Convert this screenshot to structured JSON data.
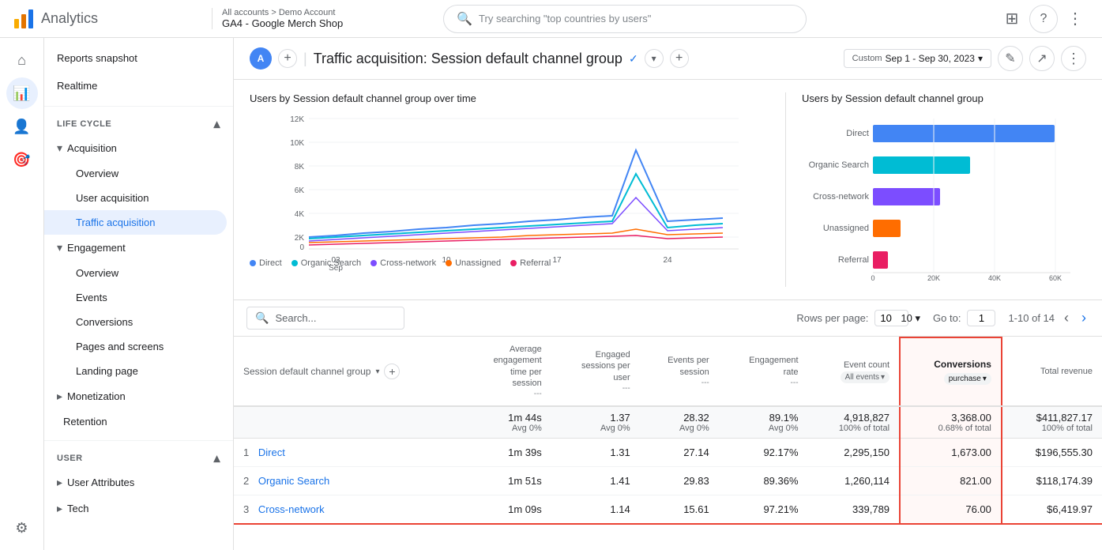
{
  "header": {
    "analytics_title": "Analytics",
    "breadcrumb": "All accounts > Demo Account",
    "property": "GA4 - Google Merch Shop",
    "search_placeholder": "Try searching \"top countries by users\"",
    "page_title": "Traffic acquisition: Session default channel group",
    "date_range": "Sep 1 - Sep 30, 2023",
    "date_label": "Custom"
  },
  "sidebar": {
    "top_items": [
      {
        "label": "Reports snapshot",
        "icon": "🏠"
      },
      {
        "label": "Realtime",
        "icon": "⏱"
      }
    ],
    "lifecycle_section": "Life cycle",
    "groups": [
      {
        "label": "Acquisition",
        "expanded": true,
        "items": [
          {
            "label": "Overview",
            "active": false
          },
          {
            "label": "User acquisition",
            "active": false
          },
          {
            "label": "Traffic acquisition",
            "active": true
          }
        ]
      },
      {
        "label": "Engagement",
        "expanded": true,
        "items": [
          {
            "label": "Overview",
            "active": false
          },
          {
            "label": "Events",
            "active": false
          },
          {
            "label": "Conversions",
            "active": false
          },
          {
            "label": "Pages and screens",
            "active": false
          },
          {
            "label": "Landing page",
            "active": false
          }
        ]
      },
      {
        "label": "Monetization",
        "expanded": false,
        "items": []
      },
      {
        "label": "Retention",
        "expanded": false,
        "items": []
      }
    ],
    "user_section": "User",
    "user_groups": [
      {
        "label": "User Attributes",
        "expanded": false
      },
      {
        "label": "Tech",
        "expanded": false
      }
    ]
  },
  "line_chart": {
    "title": "Users by Session default channel group over time",
    "x_labels": [
      "03 Sep",
      "10",
      "17",
      "24"
    ],
    "y_labels": [
      "12K",
      "10K",
      "8K",
      "6K",
      "4K",
      "2K",
      "0"
    ],
    "legend": [
      {
        "label": "Direct",
        "color": "#4285f4"
      },
      {
        "label": "Organic Search",
        "color": "#00bcd4"
      },
      {
        "label": "Cross-network",
        "color": "#7c4dff"
      },
      {
        "label": "Unassigned",
        "color": "#ff6d00"
      },
      {
        "label": "Referral",
        "color": "#e91e63"
      }
    ]
  },
  "bar_chart": {
    "title": "Users by Session default channel group",
    "categories": [
      {
        "label": "Direct",
        "value": 60000,
        "color": "#4285f4"
      },
      {
        "label": "Organic Search",
        "value": 32000,
        "color": "#00bcd4"
      },
      {
        "label": "Cross-network",
        "value": 22000,
        "color": "#7c4dff"
      },
      {
        "label": "Unassigned",
        "value": 9000,
        "color": "#ff6d00"
      },
      {
        "label": "Referral",
        "value": 5000,
        "color": "#e91e63"
      }
    ],
    "x_labels": [
      "0",
      "20K",
      "40K",
      "60K"
    ],
    "max_value": 65000
  },
  "table": {
    "search_placeholder": "Search...",
    "rows_per_page_label": "Rows per page:",
    "rows_per_page_value": "10",
    "goto_label": "Go to:",
    "goto_value": "1",
    "pagination": "1-10 of 14",
    "channel_col_label": "Session default channel group",
    "columns": [
      {
        "label": "Average engagement time per session",
        "sub": "---"
      },
      {
        "label": "Engaged sessions per user",
        "sub": "---"
      },
      {
        "label": "Events per session",
        "sub": "---"
      },
      {
        "label": "Engagement rate",
        "sub": "---"
      },
      {
        "label": "Event count",
        "sub": "All events"
      },
      {
        "label": "Conversions",
        "sub": "purchase"
      },
      {
        "label": "Total revenue",
        "sub": ""
      }
    ],
    "summary": {
      "avg_engagement": "1m 44s",
      "avg_engagement_sub": "Avg 0%",
      "engaged_sessions": "1.37",
      "engaged_sessions_sub": "Avg 0%",
      "events_per_session": "28.32",
      "events_per_session_sub": "Avg 0%",
      "engagement_rate": "89.1%",
      "engagement_rate_sub": "Avg 0%",
      "event_count": "4,918,827",
      "event_count_sub": "100% of total",
      "conversions": "3,368.00",
      "conversions_sub": "0.68% of total",
      "total_revenue": "$411,827.17",
      "total_revenue_sub": "100% of total"
    },
    "rows": [
      {
        "rank": "1",
        "channel": "Direct",
        "avg_engagement": "1m 39s",
        "engaged_sessions": "1.31",
        "events_per_session": "27.14",
        "engagement_rate": "92.17%",
        "event_count": "2,295,150",
        "conversions": "1,673.00",
        "total_revenue": "$196,555.30"
      },
      {
        "rank": "2",
        "channel": "Organic Search",
        "avg_engagement": "1m 51s",
        "engaged_sessions": "1.41",
        "events_per_session": "29.83",
        "engagement_rate": "89.36%",
        "event_count": "1,260,114",
        "conversions": "821.00",
        "total_revenue": "$118,174.39"
      },
      {
        "rank": "3",
        "channel": "Cross-network",
        "avg_engagement": "1m 09s",
        "engaged_sessions": "1.14",
        "events_per_session": "15.61",
        "engagement_rate": "97.21%",
        "event_count": "339,789",
        "conversions": "76.00",
        "total_revenue": "$6,419.97"
      }
    ]
  },
  "icons": {
    "grid": "⊞",
    "help": "?",
    "more": "⋮",
    "search": "🔍",
    "check": "✓",
    "add": "+",
    "chevron_down": "▾",
    "chevron_right": "▸",
    "chevron_left": "‹",
    "chevron_right_nav": "›",
    "calendar": "📅",
    "share": "↗",
    "edit": "✎",
    "home": "⌂",
    "timer": "◷",
    "person": "👤",
    "reports": "📊",
    "realtime": "⚡",
    "explore": "🧭",
    "advertising": "📢"
  },
  "colors": {
    "primary_blue": "#1a73e8",
    "active_nav_bg": "#e8f0fe",
    "border": "#e0e0e0",
    "highlight_red": "#ea4335",
    "direct_blue": "#4285f4",
    "organic_cyan": "#00bcd4",
    "cross_purple": "#7c4dff",
    "unassigned_orange": "#ff6d00",
    "referral_pink": "#e91e63"
  }
}
